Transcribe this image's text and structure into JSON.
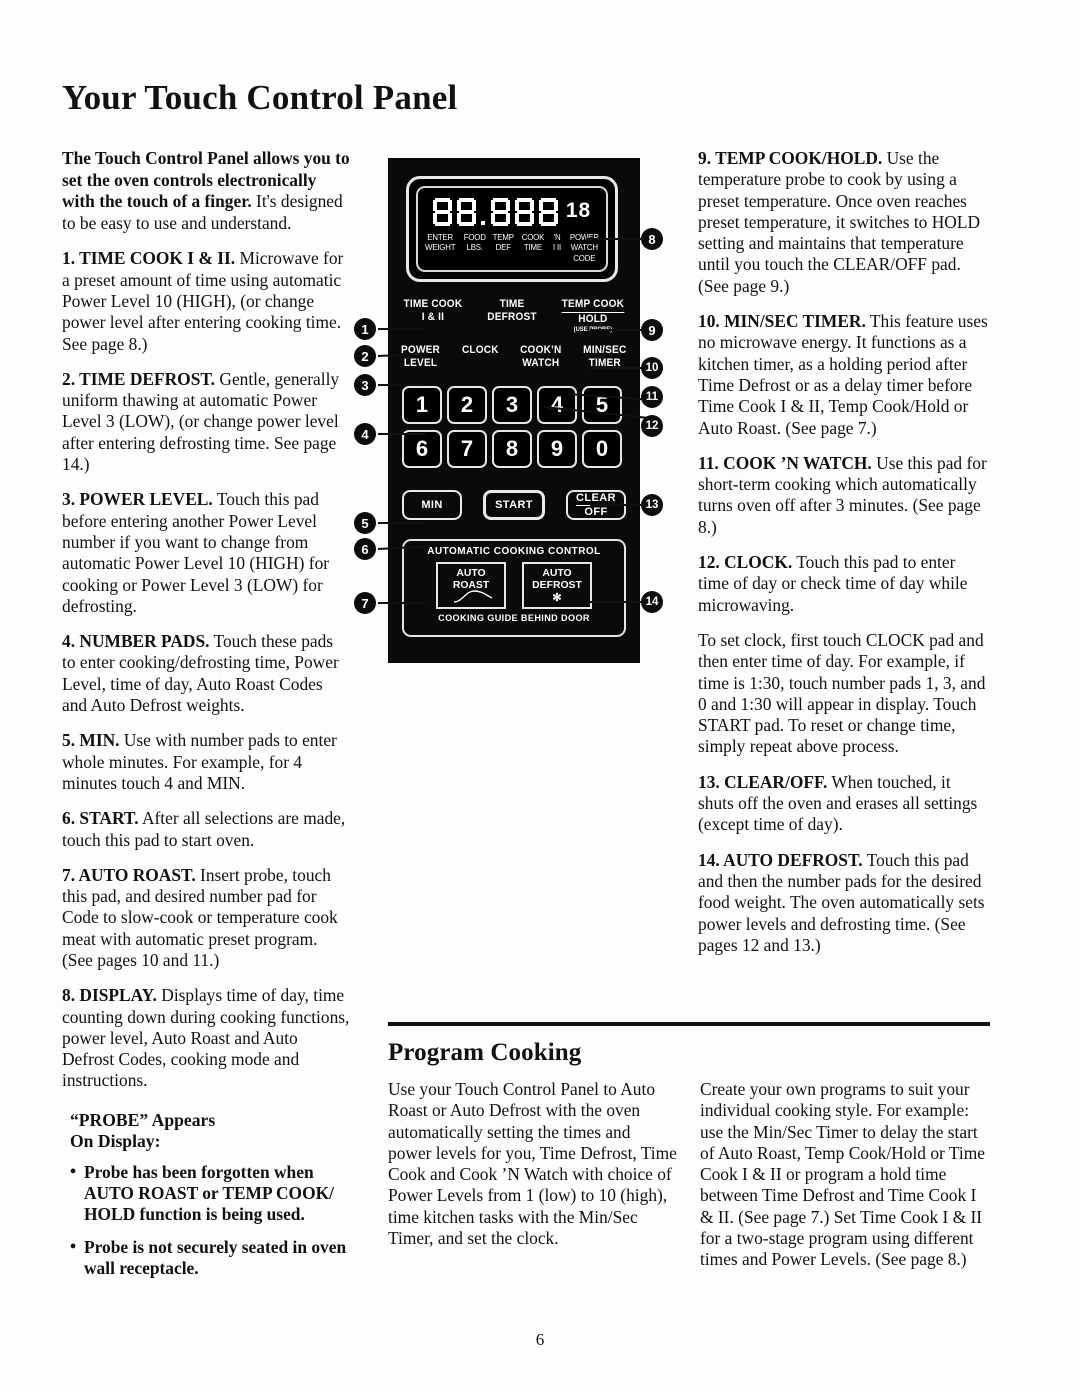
{
  "document": {
    "title": "Your Touch Control Panel",
    "page_number": "6"
  },
  "left_column": {
    "intro": {
      "bold_part": "The Touch Control Panel allows you to set the oven controls electronically with the touch of a finger.",
      "rest": " It's designed to be easy to use and understand."
    },
    "items": [
      {
        "number": "1.",
        "heading": "TIME COOK I & II.",
        "body": " Microwave for a preset amount of time using automatic Power Level 10 (HIGH), (or change power level after entering cooking time. See page 8.)"
      },
      {
        "number": "2.",
        "heading": "TIME DEFROST.",
        "body": " Gentle, generally uniform thawing at automatic Power Level 3 (LOW), (or change power level after entering defrosting time. See page 14.)"
      },
      {
        "number": "3.",
        "heading": "POWER LEVEL.",
        "body": " Touch this pad before entering another Power Level number if you want to change from automatic Power Level 10 (HIGH) for cooking or Power Level 3 (LOW) for defrosting."
      },
      {
        "number": "4.",
        "heading": "NUMBER PADS.",
        "body": " Touch these pads to enter cooking/defrosting time, Power Level, time of day, Auto Roast Codes and Auto Defrost weights."
      },
      {
        "number": "5.",
        "heading": "MIN.",
        "body": " Use with number pads to enter whole minutes. For example, for 4 minutes touch 4 and MIN."
      },
      {
        "number": "6.",
        "heading": "START.",
        "body": " After all selections are made, touch this pad to start oven."
      },
      {
        "number": "7.",
        "heading": "AUTO ROAST.",
        "body": " Insert probe, touch this pad, and desired number pad for Code to slow-cook or temperature cook meat with automatic preset program. (See pages 10 and 11.)"
      },
      {
        "number": "8.",
        "heading": "DISPLAY.",
        "body": " Displays time of day, time counting down during cooking functions, power level, Auto Roast and Auto Defrost Codes, cooking mode and instructions."
      }
    ],
    "probe_block": {
      "heading_line1": "“PROBE” Appears",
      "heading_line2": "On Display:",
      "bullets": [
        "Probe has been forgotten when AUTO ROAST or TEMP COOK/ HOLD function is being used.",
        "Probe is not securely seated in oven wall receptacle."
      ]
    }
  },
  "right_column": {
    "items": [
      {
        "number": "9.",
        "heading": "TEMP COOK/HOLD.",
        "body": " Use the temperature probe to cook by using a preset temperature. Once oven reaches preset temperature, it switches to HOLD setting and maintains that temperature until you touch the CLEAR/OFF pad. (See page 9.)"
      },
      {
        "number": "10.",
        "heading": "MIN/SEC TIMER.",
        "body": " This feature uses no microwave energy. It functions as a kitchen timer, as a holding period after Time Defrost or as a delay timer before Time Cook I & II, Temp Cook/Hold or Auto Roast. (See page 7.)"
      },
      {
        "number": "11.",
        "heading": "COOK ’N WATCH.",
        "body": " Use this pad for short-term cooking which automatically turns oven off after 3 minutes. (See page 8.)"
      },
      {
        "number": "12.",
        "heading": "CLOCK.",
        "body": " Touch this pad to enter time of day or check time of day while microwaving."
      }
    ],
    "clock_detail": "To set clock, first touch CLOCK pad and then enter time of day. For example, if time is 1:30, touch number pads 1, 3, and 0 and 1:30 will appear in display. Touch START pad. To reset or change time, simply repeat above process.",
    "items_cont": [
      {
        "number": "13.",
        "heading": "CLEAR/OFF.",
        "body": " When touched, it shuts off the oven and erases all settings (except time of day)."
      },
      {
        "number": "14.",
        "heading": "AUTO DEFROST.",
        "body": " Touch this pad and then the number pads for the desired food weight. The oven automatically sets power levels and defrosting time. (See pages 12 and 13.)"
      }
    ]
  },
  "program_cooking": {
    "title": "Program Cooking",
    "column_1": "Use your Touch Control Panel to Auto Roast or Auto Defrost with the oven automatically setting the times and power levels for you, Time Defrost, Time Cook and Cook ’N Watch with choice of Power Levels from 1 (low) to 10 (high), time kitchen tasks with the Min/Sec Timer, and set the clock.",
    "column_2": "Create your own programs to suit your individual cooking style. For example: use the Min/Sec Timer to delay the start of Auto Roast, Temp Cook/Hold or Time Cook I & II or program a hold time between Time Defrost and Time Cook I & II. (See page 7.) Set Time Cook I & II for a two-stage program using different times and Power Levels. (See page 8.)"
  },
  "control_panel": {
    "display": {
      "code_digits": "18",
      "labels": [
        {
          "line1": "ENTER",
          "line2": "WEIGHT"
        },
        {
          "line1": "FOOD",
          "line2": "LBS."
        },
        {
          "line1": "TEMP",
          "line2": "DEF"
        },
        {
          "line1": "COOK",
          "line2": "TIME"
        },
        {
          "line1": "’N",
          "line2": "I   II"
        },
        {
          "line1": "POWER",
          "line2": "WATCH",
          "line3": "CODE"
        }
      ]
    },
    "function_pads_row1": [
      {
        "line1": "TIME COOK",
        "line2": "I & II"
      },
      {
        "line1": "TIME",
        "line2": "DEFROST"
      },
      {
        "line1": "TEMP COOK",
        "line2": "HOLD",
        "sub": "(USE PROBE)"
      }
    ],
    "function_pads_row2": [
      {
        "line1": "POWER",
        "line2": "LEVEL"
      },
      {
        "line1": "CLOCK",
        "line2": ""
      },
      {
        "line1": "COOK’N",
        "line2": "WATCH"
      },
      {
        "line1": "MIN/SEC",
        "line2": "TIMER"
      }
    ],
    "keypad_row1": [
      "1",
      "2",
      "3",
      "4",
      "5"
    ],
    "keypad_row2": [
      "6",
      "7",
      "8",
      "9",
      "0"
    ],
    "action_buttons": [
      {
        "label": "MIN"
      },
      {
        "label": "START"
      },
      {
        "line1": "CLEAR",
        "line2": "OFF"
      }
    ],
    "auto_cooking": {
      "title": "AUTOMATIC COOKING CONTROL",
      "pads": [
        {
          "line1": "AUTO",
          "line2": "ROAST",
          "glyph": ""
        },
        {
          "line1": "AUTO",
          "line2": "DEFROST",
          "glyph": "✻"
        }
      ],
      "footer": "COOKING GUIDE BEHIND DOOR"
    },
    "callouts_left": [
      "1",
      "2",
      "3",
      "4",
      "5",
      "6",
      "7"
    ],
    "callouts_right": [
      "8",
      "9",
      "10",
      "11",
      "12",
      "13",
      "14"
    ]
  }
}
